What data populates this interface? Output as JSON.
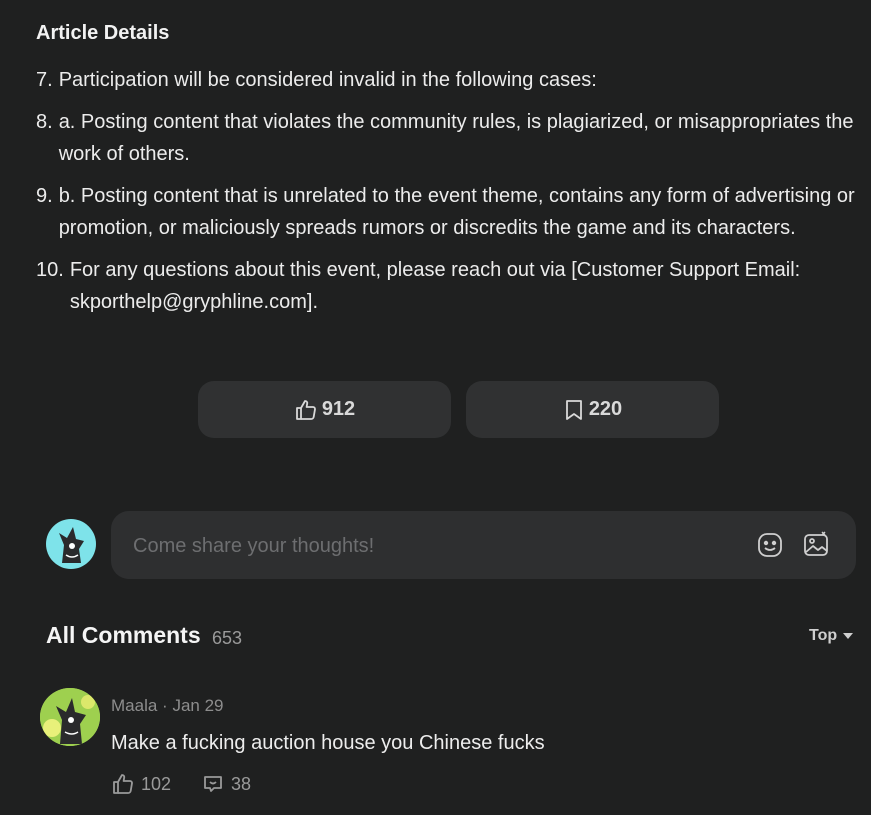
{
  "article": {
    "title": "Article Details",
    "rules": [
      {
        "num": "7.",
        "text": "Participation will be considered invalid in the following cases:"
      },
      {
        "num": "8.",
        "text": "a. Posting content that violates the community rules, is plagiarized, or misappropriates the work of others."
      },
      {
        "num": "9.",
        "text": "b. Posting content that is unrelated to the event theme, contains any form of advertising or promotion, or maliciously spreads rumors or discredits the game and its characters."
      },
      {
        "num": "10.",
        "text": "For any questions about this event, please reach out via [Customer Support Email: skporthelp@gryphline.com]."
      }
    ]
  },
  "reactions": {
    "like": {
      "icon": "thumbs-up-icon",
      "count": "912"
    },
    "bookmark": {
      "icon": "bookmark-icon",
      "count": "220"
    }
  },
  "composer": {
    "placeholder": "Come share your thoughts!",
    "tools": [
      "emoji-icon",
      "image-icon"
    ]
  },
  "comments": {
    "title": "All Comments",
    "count": "653",
    "sort": "Top",
    "items": [
      {
        "author": "Maala",
        "date": "Jan 29",
        "text": "Make a fucking auction house you Chinese fucks",
        "likes": "102",
        "replies": "38"
      }
    ]
  },
  "colors": {
    "background": "#1f2020",
    "button": "#303132",
    "composer": "#2e2f30",
    "avatar_bg": "#7ee3ea"
  }
}
